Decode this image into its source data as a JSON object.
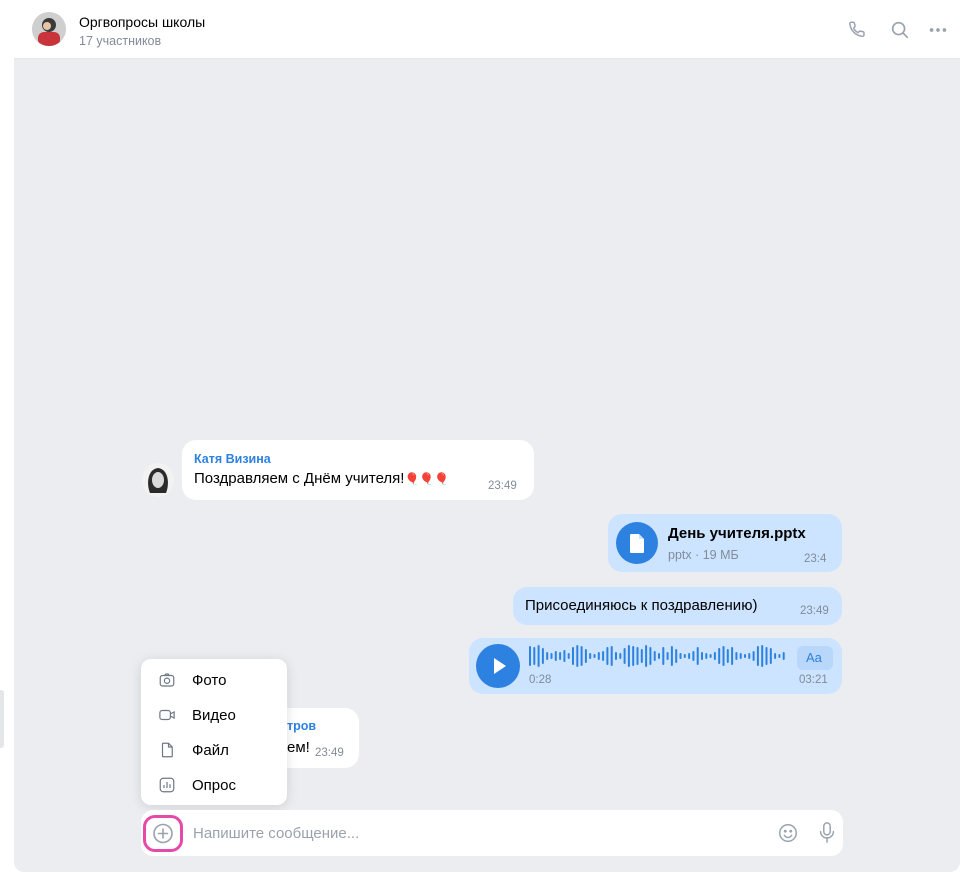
{
  "header": {
    "title": "Оргвопросы школы",
    "subtitle": "17 участников",
    "icons": [
      "phone-icon",
      "search-icon",
      "more-icon"
    ]
  },
  "messages": {
    "katya": {
      "sender": "Катя Визина",
      "text": "Поздравляем с Днём учителя!",
      "emoji": "🎈🎈🎈",
      "time": "23:49"
    },
    "file": {
      "name": "День учителя.pptx",
      "meta": "pptx · 19 МБ",
      "time": "23:4"
    },
    "join": {
      "text": "Присоединяюсь к поздравлению)",
      "time": "23:49"
    },
    "voice": {
      "elapsed": "0:28",
      "duration": "03:21",
      "transcribe_label": "Aa"
    },
    "partial": {
      "sender_fragment": "тров",
      "text_fragment": "ем!",
      "time": "23:49"
    }
  },
  "attach_menu": {
    "items": [
      {
        "label": "Фото",
        "icon": "camera-icon"
      },
      {
        "label": "Видео",
        "icon": "video-icon"
      },
      {
        "label": "Файл",
        "icon": "file-icon"
      },
      {
        "label": "Опрос",
        "icon": "poll-icon"
      }
    ]
  },
  "composer": {
    "placeholder": "Напишите сообщение..."
  },
  "colors": {
    "accent": "#2d81e0",
    "outgoing_bubble": "#cce4ff",
    "highlight_ring": "#e64aa8",
    "background": "#ebedf0"
  }
}
